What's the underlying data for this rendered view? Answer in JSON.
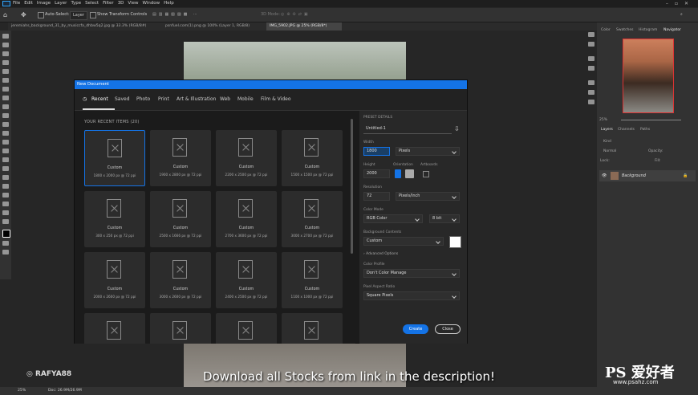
{
  "menu": [
    "File",
    "Edit",
    "Image",
    "Layer",
    "Type",
    "Select",
    "Filter",
    "3D",
    "View",
    "Window",
    "Help"
  ],
  "options_bar": {
    "auto_select": "Auto-Select:",
    "layer_select": "Layer",
    "show_transform": "Show Transform Controls",
    "mode_3d": "3D Mode:"
  },
  "doc_tabs": [
    {
      "label": "jeremiahs_background_31_by_musiccfa_dhbw5q2.jpg @ 33.3% (RGB/8#)",
      "active": false
    },
    {
      "label": "psnfuel.com(1).png @ 100% (Layer 1, RGB/8)",
      "active": false
    },
    {
      "label": "IMG_5902.JPG @ 25% (RGB/8*)",
      "active": true
    }
  ],
  "right_panel": {
    "tabs_top": [
      "Color",
      "Swatches",
      "Histogram",
      "Navigator"
    ],
    "zoom": "25%",
    "tabs_layers": [
      "Layers",
      "Channels",
      "Paths"
    ],
    "kind": "Kind",
    "blend": "Normal",
    "opacity_label": "Opacity:",
    "lock_label": "Lock:",
    "fill_label": "Fill:",
    "layer_name": "Background"
  },
  "dialog": {
    "title": "New Document",
    "tabs": [
      "Recent",
      "Saved",
      "Photo",
      "Print",
      "Art & Illustration",
      "Web",
      "Mobile",
      "Film & Video"
    ],
    "recent_title": "YOUR RECENT ITEMS (20)",
    "items": [
      {
        "name": "Custom",
        "desc": "1800 x 2000 px @ 72 ppi"
      },
      {
        "name": "Custom",
        "desc": "1900 x 2800 px @ 72 ppi"
      },
      {
        "name": "Custom",
        "desc": "2200 x 2500 px @ 72 ppi"
      },
      {
        "name": "Custom",
        "desc": "1500 x 1500 px @ 72 ppi"
      },
      {
        "name": "Custom",
        "desc": "300 x 250 px @ 72 ppi"
      },
      {
        "name": "Custom",
        "desc": "2500 x 1666 px @ 72 ppi"
      },
      {
        "name": "Custom",
        "desc": "2700 x 3600 px @ 72 ppi"
      },
      {
        "name": "Custom",
        "desc": "3000 x 2700 px @ 72 ppi"
      },
      {
        "name": "Custom",
        "desc": "2000 x 2600 px @ 72 ppi"
      },
      {
        "name": "Custom",
        "desc": "3000 x 2600 px @ 72 ppi"
      },
      {
        "name": "Custom",
        "desc": "2400 x 2500 px @ 72 ppi"
      },
      {
        "name": "Custom",
        "desc": "1100 x 1000 px @ 72 ppi"
      }
    ],
    "details": {
      "preset_label": "PRESET DETAILS",
      "name": "Untitled-1",
      "width_label": "Width",
      "width": "1800",
      "unit": "Pixels",
      "height_label": "Height",
      "height": "2000",
      "orientation_label": "Orientation",
      "artboards_label": "Artboards",
      "resolution_label": "Resolution",
      "resolution": "72",
      "res_unit": "Pixels/Inch",
      "color_mode_label": "Color Mode",
      "color_mode": "RGB Color",
      "bit": "8 bit",
      "bg_label": "Background Contents",
      "bg": "Custom",
      "advanced": "Advanced Options",
      "profile_label": "Color Profile",
      "profile": "Don't Color Manage",
      "aspect_label": "Pixel Aspect Ratio",
      "aspect": "Square Pixels"
    },
    "create": "Create",
    "close": "Close"
  },
  "status": {
    "zoom": "25%",
    "doc": "Doc: 26.9M/26.9M"
  },
  "caption": "Download all Stocks from link in the description!",
  "instagram": "RAFYA88",
  "watermark": {
    "logo": "PS 爱好者",
    "url": "www.psahz.com"
  }
}
